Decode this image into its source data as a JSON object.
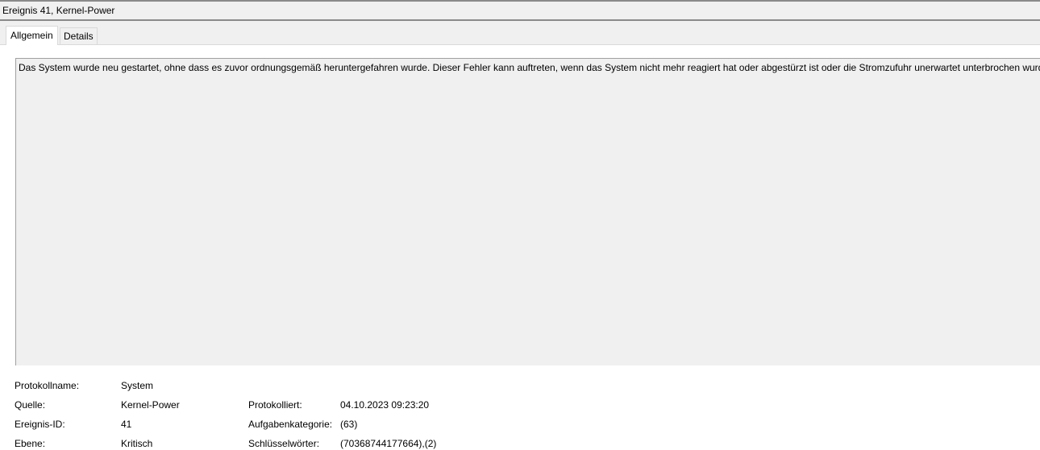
{
  "window": {
    "title": "Ereignis 41, Kernel-Power"
  },
  "tabs": [
    {
      "label": "Allgemein",
      "active": true
    },
    {
      "label": "Details",
      "active": false
    }
  ],
  "description": "Das System wurde neu gestartet, ohne dass es zuvor ordnungsgemäß heruntergefahren wurde. Dieser Fehler kann auftreten, wenn das System nicht mehr reagiert hat oder abgestürzt ist oder die Stromzufuhr unerwartet unterbrochen wurde.",
  "properties": {
    "log_name": {
      "label": "Protokollname:",
      "value": "System"
    },
    "source": {
      "label": "Quelle:",
      "value": "Kernel-Power"
    },
    "logged": {
      "label": "Protokolliert:",
      "value": "04.10.2023 09:23:20"
    },
    "event_id": {
      "label": "Ereignis-ID:",
      "value": "41"
    },
    "task_category": {
      "label": "Aufgabenkategorie:",
      "value": "(63)"
    },
    "level": {
      "label": "Ebene:",
      "value": "Kritisch"
    },
    "keywords": {
      "label": "Schlüsselwörter:",
      "value": "(70368744177664),(2)"
    }
  }
}
